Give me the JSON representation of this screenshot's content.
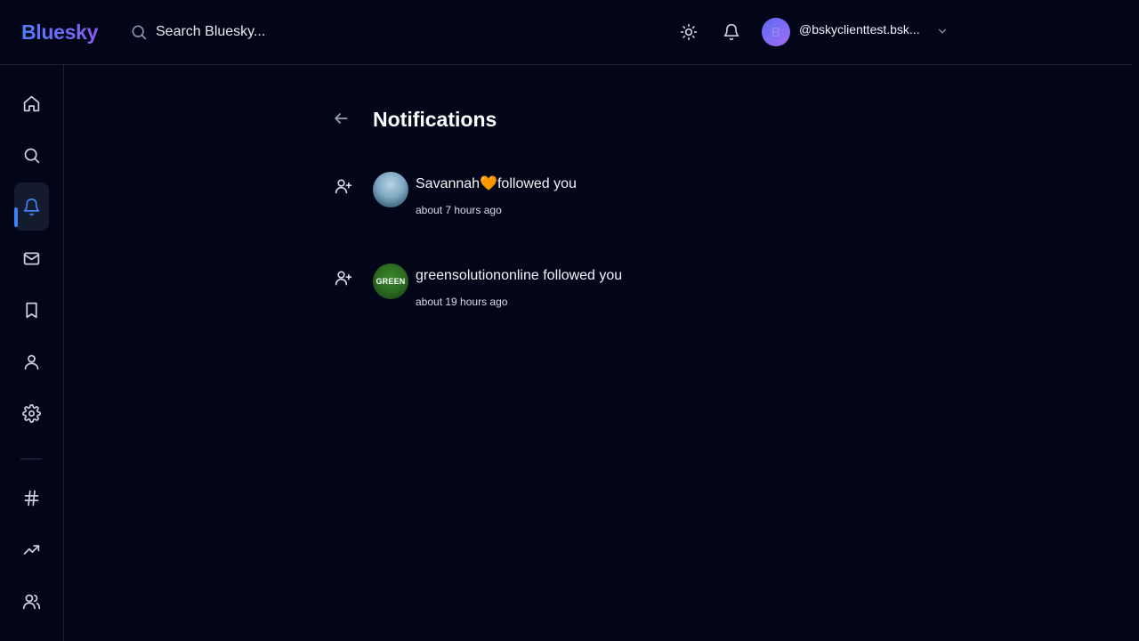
{
  "header": {
    "logo": "Bluesky",
    "search_placeholder": "Search Bluesky...",
    "account_initial": "B",
    "account_handle": "@bskyclienttest.bsk..."
  },
  "sidebar": {
    "items": [
      {
        "icon": "home-icon"
      },
      {
        "icon": "search-icon"
      },
      {
        "icon": "bell-icon",
        "active": true
      },
      {
        "icon": "mail-icon"
      },
      {
        "icon": "bookmark-icon"
      },
      {
        "icon": "user-icon"
      },
      {
        "icon": "gear-icon"
      },
      {
        "icon": "hashtag-icon"
      },
      {
        "icon": "trending-icon"
      },
      {
        "icon": "users-icon"
      }
    ]
  },
  "main": {
    "title": "Notifications",
    "notifications": [
      {
        "user": "Savannah🧡",
        "action": "followed you",
        "time": "about 7 hours ago"
      },
      {
        "user": "greensolutiononline",
        "action": "followed you",
        "time": "about 19 hours ago",
        "avatar_text": "GREEN"
      }
    ]
  },
  "colors": {
    "background": "#030618",
    "accent": "#3b82f6",
    "logo_gradient": [
      "#4f7cf7",
      "#8b5cf6"
    ]
  }
}
